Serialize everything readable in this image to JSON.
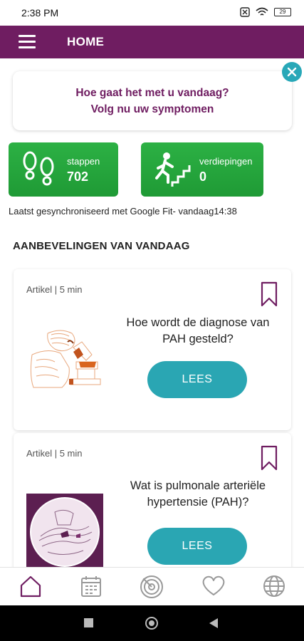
{
  "status_bar": {
    "time": "2:38 PM",
    "battery": "29"
  },
  "app_bar": {
    "title": "HOME"
  },
  "prompt": {
    "line1": "Hoe gaat het met u vandaag?",
    "line2": "Volg nu uw symptomen"
  },
  "stats": {
    "steps": {
      "label": "stappen",
      "value": "702"
    },
    "floors": {
      "label": "verdiepingen",
      "value": "0"
    }
  },
  "sync_text": "Laatst gesynchroniseerd met Google Fit- vandaag14:38",
  "section_title": "AANBEVELINGEN VAN VANDAAG",
  "recommendations": [
    {
      "meta": "Artikel | 5 min",
      "title": "Hoe wordt de diagnose van PAH gesteld?",
      "button": "LEES"
    },
    {
      "meta": "Artikel | 5 min",
      "title": "Wat is pulmonale arteriële hypertensie (PAH)?",
      "button": "LEES"
    }
  ],
  "bottom_nav": [
    "home-icon",
    "calendar-icon",
    "tracker-icon",
    "heart-icon",
    "globe-icon"
  ],
  "colors": {
    "primary": "#6f1d61",
    "accent": "#2aa6b3",
    "tile_green": "#2cb144"
  }
}
